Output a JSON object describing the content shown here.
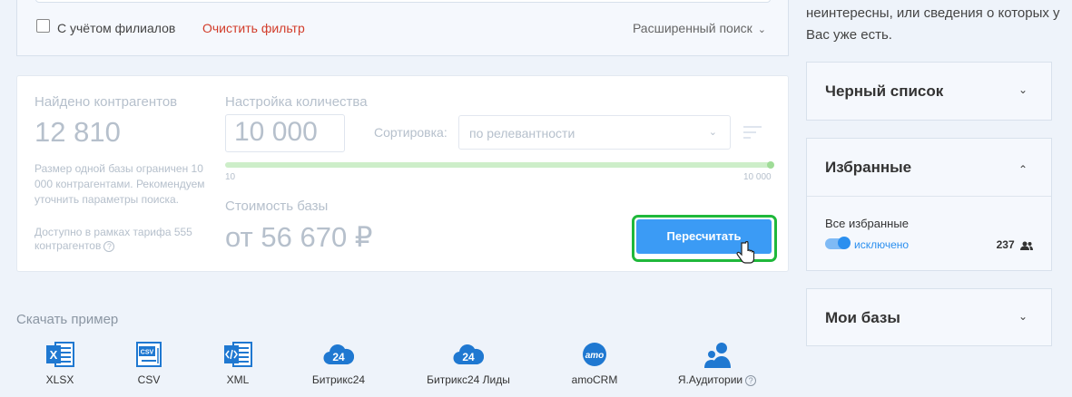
{
  "filter": {
    "branches_label": "С учётом филиалов",
    "clear_label": "Очистить фильтр",
    "advanced_label": "Расширенный поиск"
  },
  "stats": {
    "found_label": "Найдено контрагентов",
    "found_count": "12 810",
    "limit_note": "Размер одной базы ограничен 10 000 контрагентами. Рекомендуем уточнить параметры поиска.",
    "tariff_note": "Доступно в рамках тарифа 555 контрагентов",
    "qty_label": "Настройка количества",
    "qty_value": "10 000",
    "sort_label": "Сортировка:",
    "sort_value": "по релевантности",
    "slider_min": "10",
    "slider_max": "10 000",
    "slider_fraction": 1.0,
    "cost_label": "Стоимость базы",
    "cost_value": "от 56 670 ₽",
    "recalc_label": "Пересчитать"
  },
  "download": {
    "title": "Скачать пример",
    "items": [
      {
        "label": "XLSX",
        "icon": "xlsx-icon"
      },
      {
        "label": "CSV",
        "icon": "csv-icon"
      },
      {
        "label": "XML",
        "icon": "xml-icon"
      },
      {
        "label": "Битрикс24",
        "icon": "bitrix24-icon"
      },
      {
        "label": "Битрикс24 Лиды",
        "icon": "bitrix24-icon"
      },
      {
        "label": "amoCRM",
        "icon": "amocrm-icon"
      },
      {
        "label": "Я.Аудитории",
        "icon": "audience-icon"
      }
    ],
    "bitrix_badge": "24",
    "amo_badge": "amo"
  },
  "sidebar": {
    "intro_text": "неинтересны, или сведения о которых у Вас уже есть.",
    "blacklist_title": "Черный список",
    "favorites_title": "Избранные",
    "favorites_all_label": "Все избранные",
    "favorites_toggle_label": "исключено",
    "favorites_count": "237",
    "mybases_title": "Мои базы"
  },
  "colors": {
    "accent": "#3b9bf5",
    "highlight": "#1fb83b",
    "danger": "#d23c2a",
    "icon_blue": "#1f78d1"
  }
}
